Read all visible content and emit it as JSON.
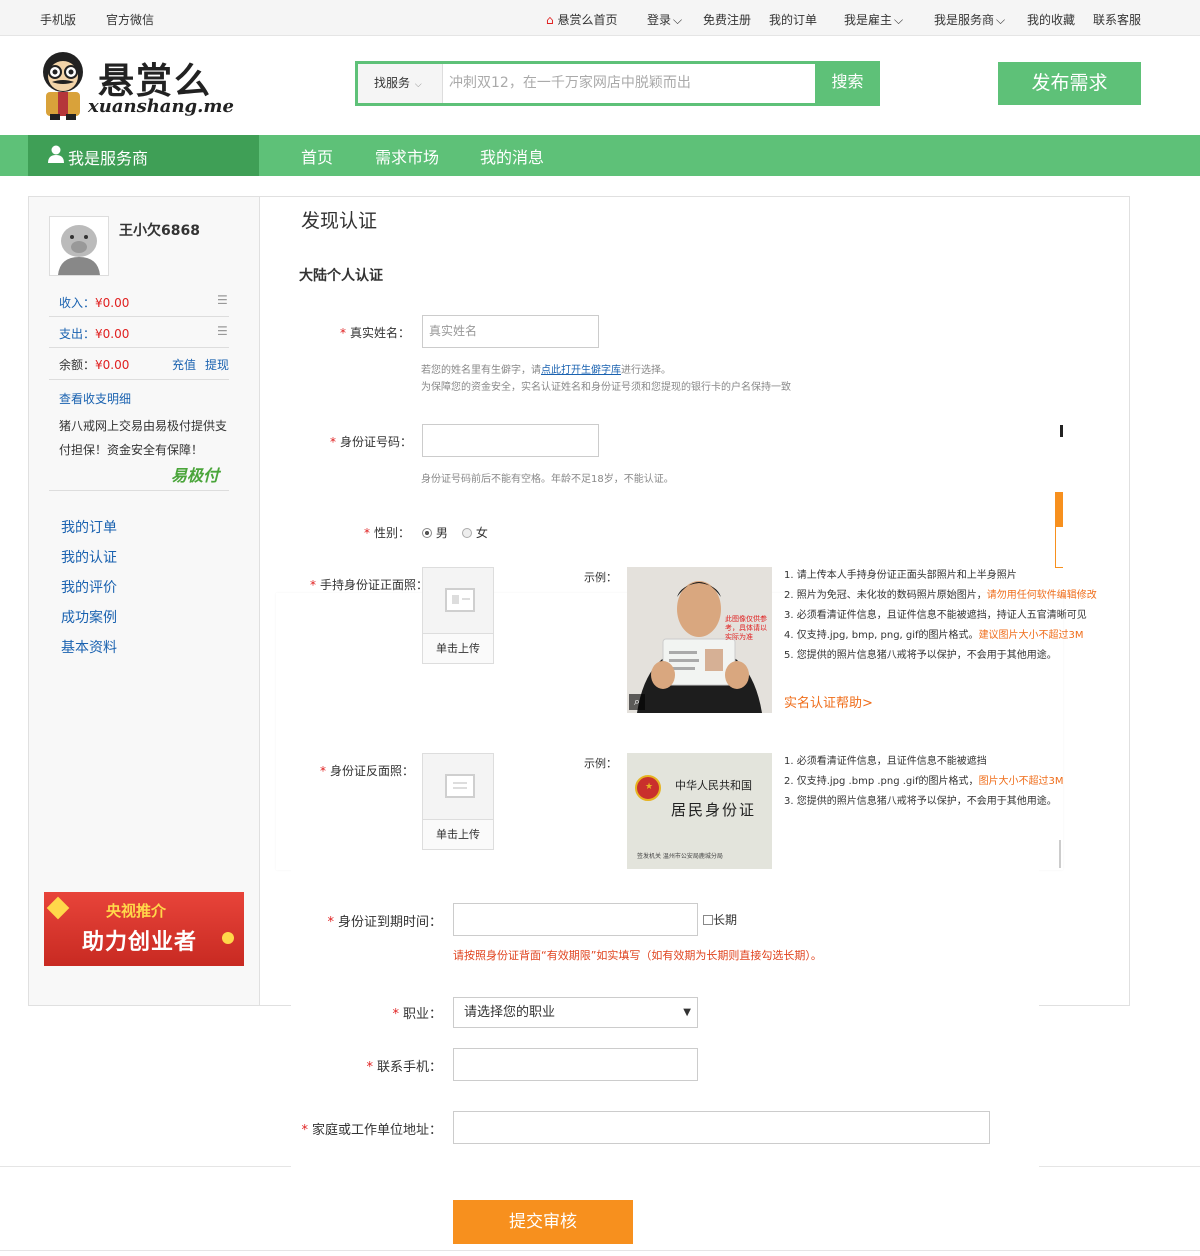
{
  "topbar": {
    "mobile": "手机版",
    "wechat": "官方微信",
    "home": "悬赏么首页",
    "login": "登录",
    "register": "免费注册",
    "my_orders": "我的订单",
    "employer": "我是雇主",
    "provider": "我是服务商",
    "favorites": "我的收藏",
    "service": "联系客服"
  },
  "header": {
    "logo_cn": "悬赏么",
    "logo_en": "xuanshang.me",
    "search_type": "找服务",
    "search_placeholder": "冲刺双12，在一千万家网店中脱颖而出",
    "search_button": "搜索",
    "publish_button": "发布需求"
  },
  "nav": {
    "role": "我是服务商",
    "items": [
      "首页",
      "需求市场",
      "我的消息"
    ]
  },
  "sidebar": {
    "username": "王小欠6868",
    "income_label": "收入：",
    "income_value": "¥0.00",
    "expense_label": "支出：",
    "expense_value": "¥0.00",
    "balance_label": "余额：",
    "balance_value": "¥0.00",
    "recharge": "充值",
    "withdraw": "提现",
    "view_details": "查看收支明细",
    "guarantee_line1": "猪八戒网上交易由易极付提供支",
    "guarantee_line2": "付担保！资金安全有保障！",
    "yjf_logo": "易极付",
    "menu": [
      "我的订单",
      "我的认证",
      "我的评价",
      "成功案例",
      "基本资料"
    ],
    "banner_line1": "央视推介",
    "banner_line2": "助力创业者"
  },
  "main": {
    "title": "发现认证",
    "subtitle": "大陆个人认证",
    "star": "*",
    "name_label": "真实姓名：",
    "name_placeholder": "真实姓名",
    "name_hint1_a": "若您的姓名里有生僻字，请",
    "name_hint1_link": "点此打开生僻字库",
    "name_hint1_b": "进行选择。",
    "name_hint2": "为保障您的资金安全，实名认证姓名和身份证号须和您提现的银行卡的户名保持一致",
    "id_label": "身份证号码：",
    "id_hint": "身份证号码前后不能有空格。年龄不足18岁，不能认证。",
    "gender_label": "性别：",
    "gender_male": "男",
    "gender_female": "女",
    "front_label": "手持身份证正面照：",
    "upload_button": "单击上传",
    "example_label": "示例：",
    "front_rules": [
      {
        "text": "1. 请上传本人手持身份证正面头部照片和上半身照片",
        "accent": ""
      },
      {
        "text": "2. 照片为免冠、未化妆的数码照片原始图片，",
        "accent": "请勿用任何软件编辑修改"
      },
      {
        "text": "3. 必须看清证件信息，且证件信息不能被遮挡，持证人五官清晰可见",
        "accent": ""
      },
      {
        "text": "4. 仅支持.jpg, bmp, png, gif的图片格式。",
        "accent": "建议图片大小不超过3M"
      },
      {
        "text": "5. 您提供的照片信息猪八戒将予以保护，不会用于其他用途。",
        "accent": ""
      }
    ],
    "photo_note": "此图像仅供参考，具体请以实际为准",
    "help_link": "实名认证帮助>",
    "back_label": "身份证反面照：",
    "back_rules": [
      {
        "text": "1. 必须看清证件信息，且证件信息不能被遮挡",
        "accent": ""
      },
      {
        "text": "2. 仅支持.jpg .bmp .png .gif的图片格式，",
        "accent": "图片大小不超过3M"
      },
      {
        "text": "3. 您提供的照片信息猪八戒将予以保护，不会用于其他用途。",
        "accent": ""
      }
    ],
    "card_line1": "中华人民共和国",
    "card_line2": "居民身份证",
    "card_line3": "签发机关    温州市公安局鹿城分局",
    "expiry_label": "身份证到期时间：",
    "long_term": "长期",
    "expiry_hint": "请按照身份证背面“有效期限”如实填写（如有效期为长期则直接勾选长期）。",
    "job_label": "职业：",
    "job_placeholder": "请选择您的职业",
    "phone_label": "联系手机：",
    "address_label": "家庭或工作单位地址：",
    "submit": "提交审核"
  },
  "colors": {
    "green": "#5ec178",
    "dark_green": "#3f9f56",
    "orange": "#f7901e",
    "red": "#e02020",
    "link": "#1a62b0"
  }
}
